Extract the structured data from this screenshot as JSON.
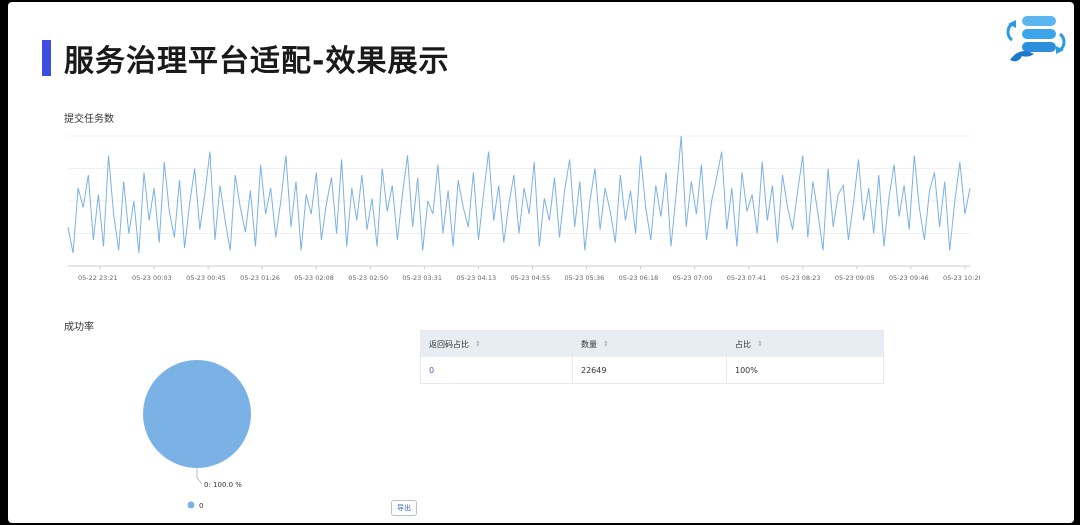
{
  "page": {
    "title": "服务治理平台适配-效果展示",
    "submit_label": "提交任务数",
    "success_label": "成功率",
    "export_label": "导出"
  },
  "colors": {
    "accent": "#3d4de0",
    "series": "#7ab2e6",
    "pie": "#7ab2e6"
  },
  "logo": {
    "icon": "database-sync-dolphin-icon"
  },
  "chart_data": [
    {
      "type": "line",
      "title": "提交任务数",
      "xlabel": "",
      "ylabel": "",
      "grid": true,
      "x_ticks": [
        "05-22 23:21",
        "05-23 00:03",
        "05-23 00:45",
        "05-23 01:26",
        "05-23 02:08",
        "05-23 02:50",
        "05-23 03:31",
        "05-23 04:13",
        "05-23 04:55",
        "05-23 05:36",
        "05-23 06:18",
        "05-23 07:00",
        "05-23 07:41",
        "05-23 08:23",
        "05-23 09:05",
        "05-23 09:46",
        "05-23 10:28"
      ],
      "series": [
        {
          "values": [
            30,
            10,
            60,
            45,
            70,
            20,
            55,
            15,
            85,
            40,
            12,
            65,
            25,
            50,
            10,
            72,
            35,
            60,
            18,
            80,
            42,
            22,
            66,
            14,
            48,
            75,
            28,
            55,
            88,
            20,
            62,
            35,
            12,
            70,
            45,
            26,
            58,
            15,
            78,
            40,
            60,
            22,
            50,
            85,
            30,
            65,
            12,
            55,
            40,
            72,
            20,
            48,
            68,
            25,
            82,
            15,
            60,
            35,
            70,
            28,
            52,
            15,
            75,
            42,
            62,
            20,
            55,
            85,
            30,
            68,
            12,
            50,
            40,
            78,
            25,
            58,
            15,
            66,
            45,
            30,
            72,
            20,
            55,
            88,
            35,
            62,
            18,
            48,
            70,
            25,
            60,
            40,
            80,
            15,
            52,
            35,
            68,
            22,
            58,
            82,
            30,
            65,
            12,
            50,
            75,
            28,
            60,
            42,
            18,
            70,
            35,
            58,
            25,
            85,
            45,
            20,
            62,
            38,
            72,
            15,
            55,
            100,
            30,
            65,
            40,
            78,
            20,
            50,
            68,
            88,
            28,
            60,
            15,
            72,
            42,
            55,
            25,
            80,
            35,
            62,
            18,
            70,
            45,
            28,
            58,
            85,
            22,
            65,
            40,
            12,
            75,
            30,
            55,
            62,
            20,
            48,
            82,
            35,
            60,
            25,
            70,
            15,
            52,
            78,
            38,
            62,
            28,
            85,
            45,
            20,
            58,
            72,
            30,
            65,
            12,
            50,
            80,
            40,
            60
          ]
        }
      ]
    },
    {
      "type": "pie",
      "title": "成功率",
      "slices": [
        {
          "name": "0",
          "value": 100.0,
          "label": "0: 100.0 %"
        }
      ],
      "legend": "bottom"
    },
    {
      "type": "table",
      "columns": [
        "返回码占比",
        "数量",
        "占比"
      ],
      "rows": [
        [
          "0",
          "22649",
          "100%"
        ]
      ]
    }
  ]
}
